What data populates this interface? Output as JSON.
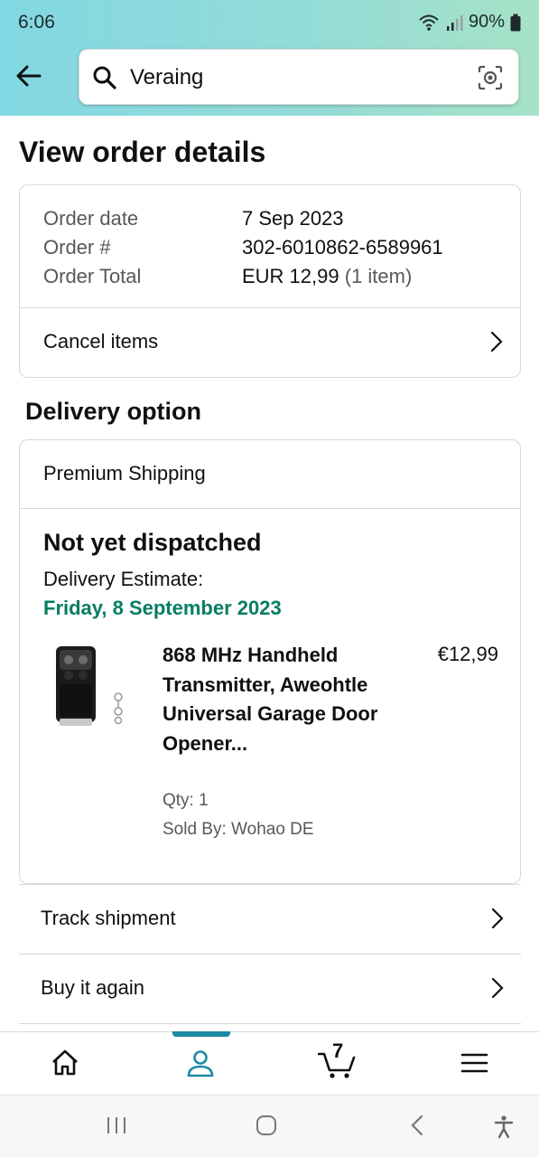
{
  "status_bar": {
    "time": "6:06",
    "battery": "90%"
  },
  "search": {
    "query": "Veraing",
    "icons": [
      "search-icon",
      "camera-search-icon"
    ]
  },
  "page": {
    "title": "View order details"
  },
  "order": {
    "labels": {
      "date": "Order date",
      "number": "Order #",
      "total": "Order Total"
    },
    "values": {
      "date": "7 Sep 2023",
      "number": "302-6010862-6589961",
      "total": "EUR 12,99",
      "items": "(1 item)"
    },
    "cancel_label": "Cancel items"
  },
  "delivery": {
    "section_title": "Delivery option",
    "shipping_type": "Premium Shipping",
    "status": "Not yet dispatched",
    "estimate_label": "Delivery Estimate:",
    "estimate_date": "Friday, 8 September 2023",
    "estimate_color": "#067d62",
    "product": {
      "title": "868 MHz Handheld Transmitter, Aweohtle Universal Garage Door Opener...",
      "price": "€12,99",
      "qty": "Qty: 1",
      "sold_by": "Sold By: Wohao DE"
    }
  },
  "actions": {
    "track": "Track shipment",
    "buy_again": "Buy it again"
  },
  "bottom_nav": {
    "items": [
      "home-icon",
      "account-icon",
      "cart-icon",
      "menu-icon"
    ],
    "cart_count": "7",
    "active": "account-icon",
    "accent": "#1b8aa5"
  },
  "system_nav": [
    "recents-icon",
    "home-circle-icon",
    "back-chevron-icon",
    "accessibility-icon"
  ]
}
